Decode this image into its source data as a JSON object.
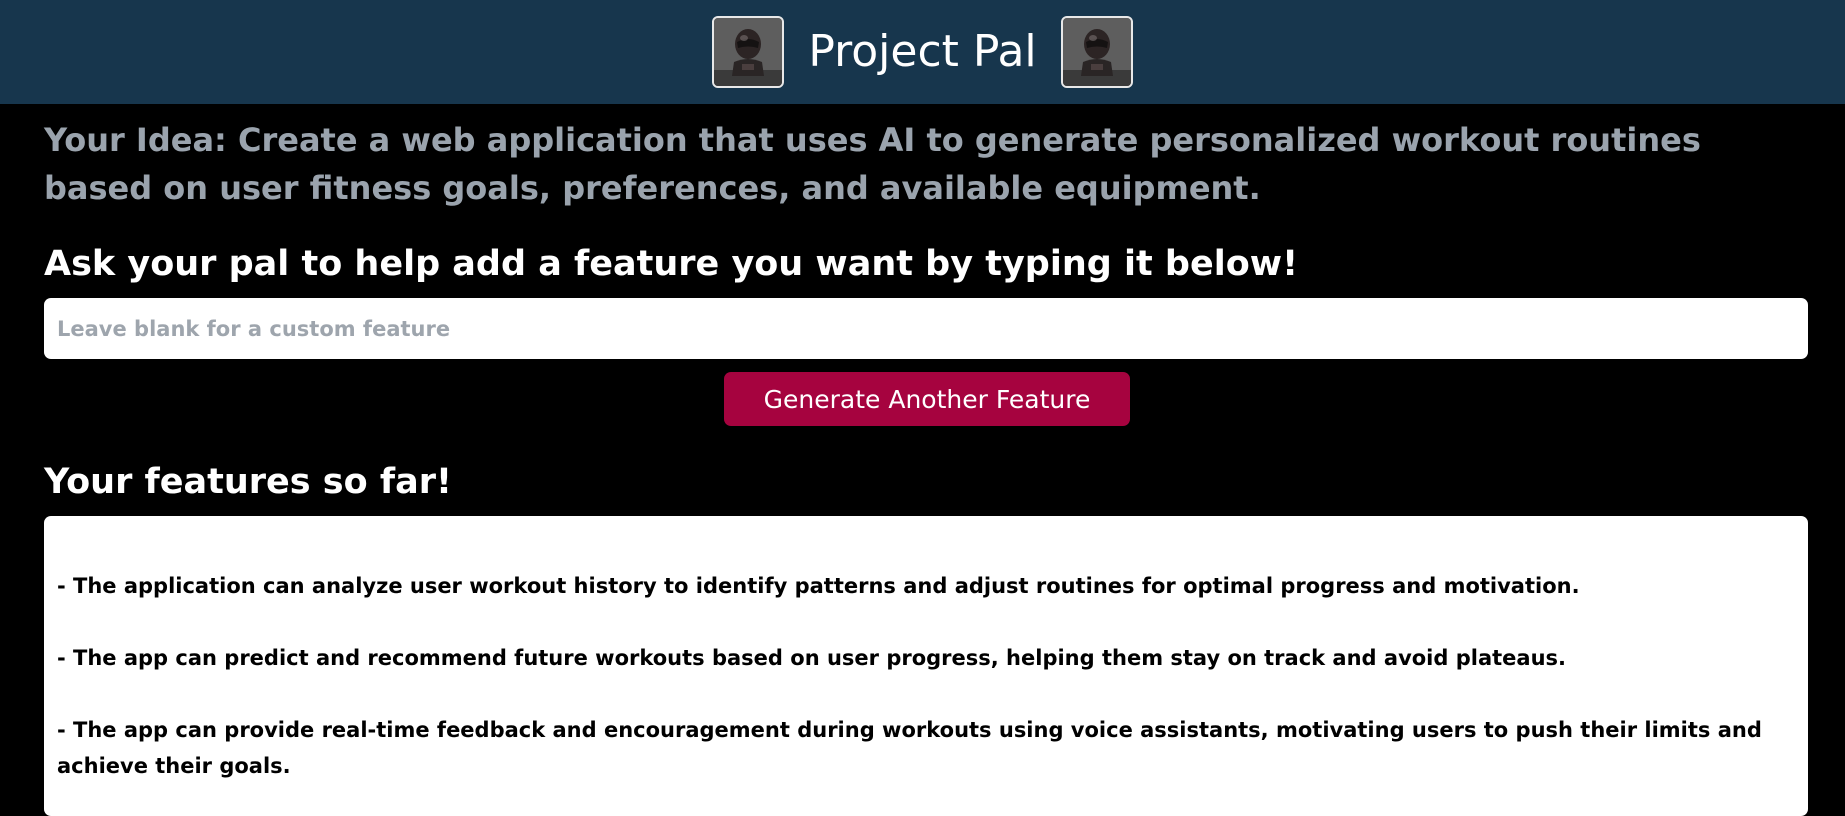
{
  "header": {
    "title": "Project Pal",
    "background_color": "#17364d",
    "left_avatar_icon": "robot-avatar-icon",
    "right_avatar_icon": "robot-avatar-icon"
  },
  "idea": {
    "text": "Your Idea: Create a web application that uses AI to generate personalized workout routines based on user fitness goals, preferences, and available equipment."
  },
  "ask": {
    "heading": "Ask your pal to help add a feature you want by typing it below!",
    "input_value": "",
    "input_placeholder": "Leave blank for a custom feature",
    "button_label": "Generate Another Feature",
    "button_color": "#a6033f"
  },
  "features": {
    "heading": "Your features so far!",
    "items": [
      "-  The application can analyze user workout history to identify patterns and adjust routines for optimal progress and motivation.",
      "- The app can predict and recommend future workouts based on user progress, helping them stay on track and avoid plateaus.",
      "- The app can provide real-time feedback and encouragement during workouts using voice assistants, motivating users to push their limits and achieve their goals."
    ]
  }
}
